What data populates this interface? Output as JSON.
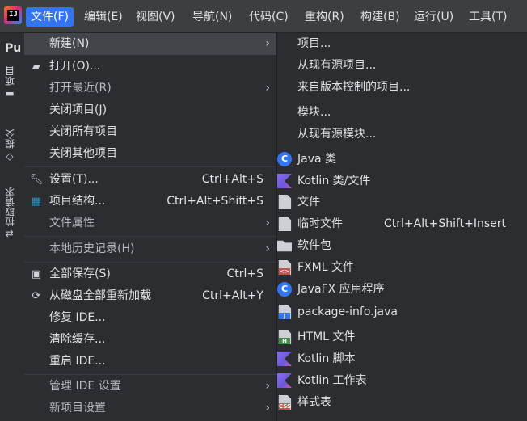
{
  "menubar": {
    "logo_text": "IJ",
    "items": [
      {
        "label": "文件(F)"
      },
      {
        "label": "编辑(E)"
      },
      {
        "label": "视图(V)"
      },
      {
        "label": "导航(N)"
      },
      {
        "label": "代码(C)"
      },
      {
        "label": "重构(R)"
      },
      {
        "label": "构建(B)"
      },
      {
        "label": "运行(U)"
      },
      {
        "label": "工具(T)"
      }
    ]
  },
  "toolstrip": {
    "project_abbr": "Pu",
    "tabs": [
      {
        "label": "项目",
        "icon": "folder-icon"
      },
      {
        "label": "提交",
        "icon": "commit-icon"
      },
      {
        "label": "拉取请求",
        "icon": "pull-request-icon"
      }
    ]
  },
  "file_menu": {
    "items": [
      {
        "label": "新建(N)",
        "shortcut": "",
        "icon": "",
        "submenu": true
      },
      {
        "label": "打开(O)...",
        "shortcut": "",
        "icon": "open-folder-icon"
      },
      {
        "label": "打开最近(R)",
        "shortcut": "",
        "icon": "",
        "submenu": true
      },
      {
        "label": "关闭项目(J)",
        "shortcut": "",
        "icon": ""
      },
      {
        "label": "关闭所有项目",
        "shortcut": "",
        "icon": ""
      },
      {
        "label": "关闭其他项目",
        "shortcut": "",
        "icon": ""
      },
      {
        "label": "设置(T)...",
        "shortcut": "Ctrl+Alt+S",
        "icon": "wrench-icon"
      },
      {
        "label": "项目结构...",
        "shortcut": "Ctrl+Alt+Shift+S",
        "icon": "project-structure-icon"
      },
      {
        "label": "文件属性",
        "shortcut": "",
        "icon": "",
        "submenu": true
      },
      {
        "label": "本地历史记录(H)",
        "shortcut": "",
        "icon": "",
        "submenu": true
      },
      {
        "label": "全部保存(S)",
        "shortcut": "Ctrl+S",
        "icon": "save-icon"
      },
      {
        "label": "从磁盘全部重新加载",
        "shortcut": "Ctrl+Alt+Y",
        "icon": "reload-icon"
      },
      {
        "label": "修复 IDE...",
        "shortcut": "",
        "icon": ""
      },
      {
        "label": "清除缓存...",
        "shortcut": "",
        "icon": ""
      },
      {
        "label": "重启 IDE...",
        "shortcut": "",
        "icon": ""
      },
      {
        "label": "管理 IDE 设置",
        "shortcut": "",
        "icon": "",
        "submenu": true
      },
      {
        "label": "新项目设置",
        "shortcut": "",
        "icon": "",
        "submenu": true
      }
    ]
  },
  "new_submenu": {
    "items": [
      {
        "label": "项目...",
        "shortcut": ""
      },
      {
        "label": "从现有源项目...",
        "shortcut": ""
      },
      {
        "label": "来自版本控制的项目...",
        "shortcut": ""
      },
      {
        "label": "模块...",
        "shortcut": ""
      },
      {
        "label": "从现有源模块...",
        "shortcut": ""
      },
      {
        "label": "Java 类",
        "shortcut": "",
        "icon": "java-class-icon"
      },
      {
        "label": "Kotlin 类/文件",
        "shortcut": "",
        "icon": "kotlin-file-icon"
      },
      {
        "label": "文件",
        "shortcut": "",
        "icon": "file-icon"
      },
      {
        "label": "临时文件",
        "shortcut": "Ctrl+Alt+Shift+Insert",
        "icon": "scratch-file-icon"
      },
      {
        "label": "软件包",
        "shortcut": "",
        "icon": "package-icon"
      },
      {
        "label": "FXML 文件",
        "shortcut": "",
        "icon": "fxml-file-icon"
      },
      {
        "label": "JavaFX 应用程序",
        "shortcut": "",
        "icon": "javafx-app-icon"
      },
      {
        "label": "package-info.java",
        "shortcut": "",
        "icon": "package-info-icon"
      },
      {
        "label": "HTML 文件",
        "shortcut": "",
        "icon": "html-file-icon"
      },
      {
        "label": "Kotlin 脚本",
        "shortcut": "",
        "icon": "kotlin-script-icon"
      },
      {
        "label": "Kotlin 工作表",
        "shortcut": "",
        "icon": "kotlin-worksheet-icon"
      },
      {
        "label": "样式表",
        "shortcut": "",
        "icon": "stylesheet-icon"
      }
    ]
  },
  "colors": {
    "accent": "#3574f0",
    "menu_bg": "#2b2d30",
    "menubar_bg": "#3c3f41",
    "highlight": "#43454a",
    "text": "#dfe1e5"
  }
}
